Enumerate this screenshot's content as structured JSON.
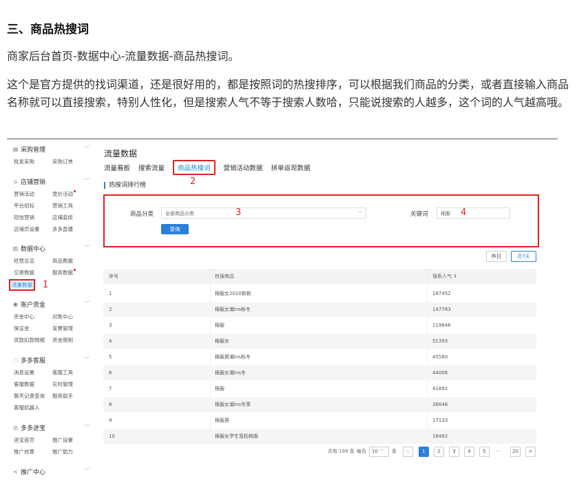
{
  "article": {
    "heading": "三、商品热搜词",
    "path": "商家后台首页-数据中心-流量数据-商品热搜词。",
    "paragraph": "这个是官方提供的找词渠道，还是很好用的，都是按照词的热搜排序，可以根据我们商品的分类，或者直接输入商品名称就可以直接搜索，特别人性化，但是搜索人气不等于搜索人数哈，只能说搜索的人越多，这个词的人气越高哦。"
  },
  "sidebar": {
    "sections": [
      {
        "title": "采购管理",
        "icon": "clipboard-icon",
        "items": [
          "批发采购",
          "采购订单"
        ]
      },
      {
        "title": "店铺营销",
        "icon": "shop-icon",
        "items": [
          "营销活动",
          "竞价活动",
          "平台招标",
          "营销工具",
          "短信营销",
          "店铺装修",
          "店铺页设置",
          "多多直播"
        ]
      },
      {
        "title": "数据中心",
        "icon": "chart-icon",
        "items": [
          "经营总览",
          "商品数据",
          "交易数据",
          "服务数据",
          "流量数据"
        ]
      },
      {
        "title": "账户资金",
        "icon": "wallet-icon",
        "items": [
          "资金中心",
          "对账中心",
          "保证金",
          "发票管理",
          "货款扣款明细",
          "资金限制"
        ]
      },
      {
        "title": "多多客服",
        "icon": "chat-icon",
        "items": [
          "消息设置",
          "客服工具",
          "客服数据",
          "实时管理",
          "聊天记录查询",
          "服务助手",
          "客服机器人"
        ]
      },
      {
        "title": "多多进宝",
        "icon": "coin-icon",
        "items": [
          "进宝首页",
          "推广设置",
          "推广效果",
          "推广助力"
        ]
      },
      {
        "title": "推广中心",
        "icon": "promote-icon",
        "items": []
      }
    ]
  },
  "main": {
    "title": "流量数据",
    "tabs": [
      "流量看板",
      "搜索流量",
      "商品热搜词",
      "营销活动数据",
      "拼单返现数据"
    ],
    "ranking_heading": "热搜词排行榜",
    "filter": {
      "category_label": "商品分类",
      "category_value": "全部商品分类",
      "keyword_label": "关键词",
      "keyword_value": "棉服",
      "query_button": "查询"
    },
    "range_buttons": [
      "昨日",
      "近7天"
    ],
    "table": {
      "headers": [
        "序号",
        "热搜商品",
        "搜索人气"
      ],
      "sort_icon": "⇕",
      "rows": [
        [
          "1",
          "棉服女2020新款",
          "187452"
        ],
        [
          "2",
          "棉服女潮ins秋冬",
          "147783"
        ],
        [
          "3",
          "棉服",
          "119646"
        ],
        [
          "4",
          "棉服女",
          "51393"
        ],
        [
          "5",
          "棉服男潮ins秋冬",
          "45580"
        ],
        [
          "6",
          "棉服女潮ins冬",
          "44006"
        ],
        [
          "7",
          "棉服",
          "41892"
        ],
        [
          "8",
          "棉服女潮ins冬季",
          "36646"
        ],
        [
          "9",
          "棉服男",
          "17133"
        ],
        [
          "10",
          "棉服女学生宽松韩版",
          "16482"
        ]
      ]
    },
    "pagination": {
      "total": "共有 199 条",
      "per_page_label": "每页",
      "per_page_value": "10",
      "per_page_unit": "条",
      "pages": [
        "1",
        "2",
        "3",
        "4",
        "5"
      ],
      "ellipsis": "···",
      "last_page": "20",
      "prev": "<",
      "next": ">"
    }
  },
  "annotations": {
    "m1": "1",
    "m2": "2",
    "m3": "3",
    "m4": "4"
  }
}
